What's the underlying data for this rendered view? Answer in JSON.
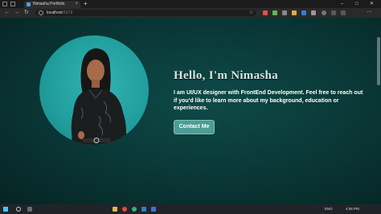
{
  "browser": {
    "tab_title": "Nimasha Portfolio",
    "tab_close": "×",
    "new_tab": "+",
    "url_host": "localhost",
    "url_port": ":5173",
    "window_controls": [
      "–",
      "□",
      "✕"
    ],
    "nav_back": "←",
    "nav_forward": "→",
    "nav_reload": "↻",
    "star": "☆",
    "menu": "⋯"
  },
  "hero": {
    "title": "Hello, I'm Nimasha",
    "description": "I am UI/UX designer with FrontEnd Development. Feel free to reach out if you'd like to learn more about my background, education or experiences.",
    "cta_label": "Contact Me"
  },
  "taskbar": {
    "lang": "ENG",
    "time": "4:06 PM",
    "icons": [
      "start-icon",
      "search-icon",
      "task-view-icon",
      "explorer-icon",
      "chrome-icon",
      "edge-icon",
      "vscode-icon",
      "store-icon"
    ]
  },
  "colors": {
    "accent": "#4f9b95",
    "bg_center": "#0e4a48",
    "bg_edge": "#062423",
    "avatar_bg": "#229f9f"
  }
}
